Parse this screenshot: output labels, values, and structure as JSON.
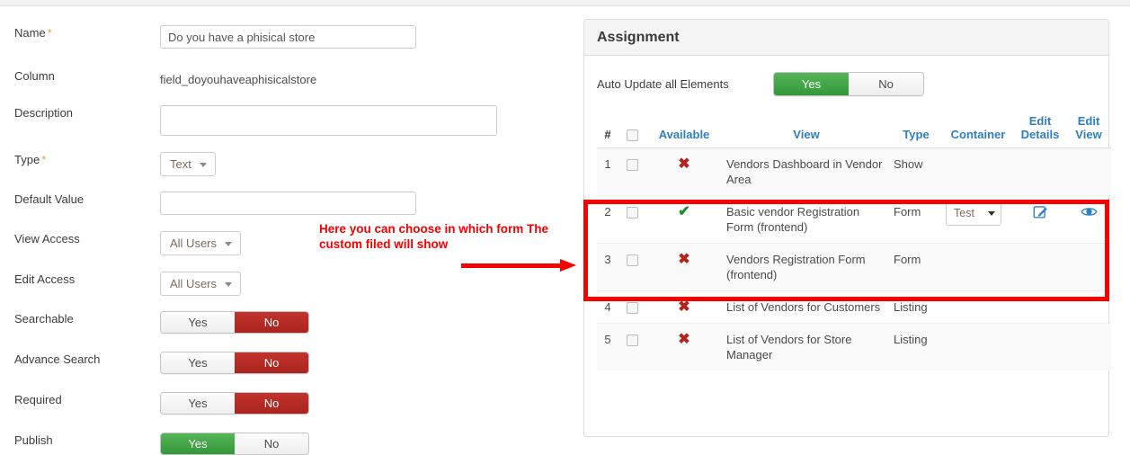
{
  "form": {
    "fields": [
      {
        "label": "Name",
        "required": true,
        "control": "text",
        "value": "Do you have a phisical store",
        "placeholder": ""
      },
      {
        "label": "Column",
        "required": false,
        "control": "static",
        "value": "field_doyouhaveaphisicalstore"
      },
      {
        "label": "Description",
        "required": false,
        "control": "textarea",
        "value": "",
        "placeholder": ""
      },
      {
        "label": "Type",
        "required": true,
        "control": "select",
        "value": "Text"
      },
      {
        "label": "Default Value",
        "required": false,
        "control": "text",
        "value": "",
        "placeholder": ""
      },
      {
        "label": "View Access",
        "required": false,
        "control": "select",
        "value": "All Users"
      },
      {
        "label": "Edit Access",
        "required": false,
        "control": "select",
        "value": "All Users"
      },
      {
        "label": "Searchable",
        "required": false,
        "control": "toggle",
        "value": "No"
      },
      {
        "label": "Advance Search",
        "required": false,
        "control": "toggle",
        "value": "No"
      },
      {
        "label": "Required",
        "required": false,
        "control": "toggle",
        "value": "No"
      },
      {
        "label": "Publish",
        "required": false,
        "control": "toggle",
        "value": "Yes"
      }
    ],
    "toggle_yes_label": "Yes",
    "toggle_no_label": "No"
  },
  "annotation": {
    "text": "Here you can choose in which form The custom filed will show",
    "color": "#f70000"
  },
  "panel": {
    "title": "Assignment",
    "auto_update": {
      "label": "Auto Update all Elements",
      "yes_label": "Yes",
      "no_label": "No",
      "value": "Yes"
    },
    "table": {
      "headers": {
        "num": "#",
        "select_all": "",
        "available": "Available",
        "view": "View",
        "type": "Type",
        "container": "Container",
        "edit_details": "Edit Details",
        "edit_view": "Edit View"
      },
      "rows": [
        {
          "num": "1",
          "available": "no",
          "view": "Vendors Dashboard in Vendor Area",
          "type": "Show",
          "container": "",
          "edit_details": false,
          "edit_view": false
        },
        {
          "num": "2",
          "available": "yes",
          "view": "Basic vendor Registration Form (frontend)",
          "type": "Form",
          "container": "Test",
          "edit_details": true,
          "edit_view": true
        },
        {
          "num": "3",
          "available": "no",
          "view": "Vendors Registration Form (frontend)",
          "type": "Form",
          "container": "",
          "edit_details": false,
          "edit_view": false
        },
        {
          "num": "4",
          "available": "no",
          "view": "List of Vendors for Customers",
          "type": "Listing",
          "container": "",
          "edit_details": false,
          "edit_view": false
        },
        {
          "num": "5",
          "available": "no",
          "view": "List of Vendors for Store Manager",
          "type": "Listing",
          "container": "",
          "edit_details": false,
          "edit_view": false
        }
      ],
      "mark_yes": "✔",
      "mark_no": "✖"
    }
  },
  "colors": {
    "green": "#3e9b42",
    "red": "#b0251d",
    "link_blue": "#2f7fc1",
    "annotation_red": "#f70000"
  }
}
